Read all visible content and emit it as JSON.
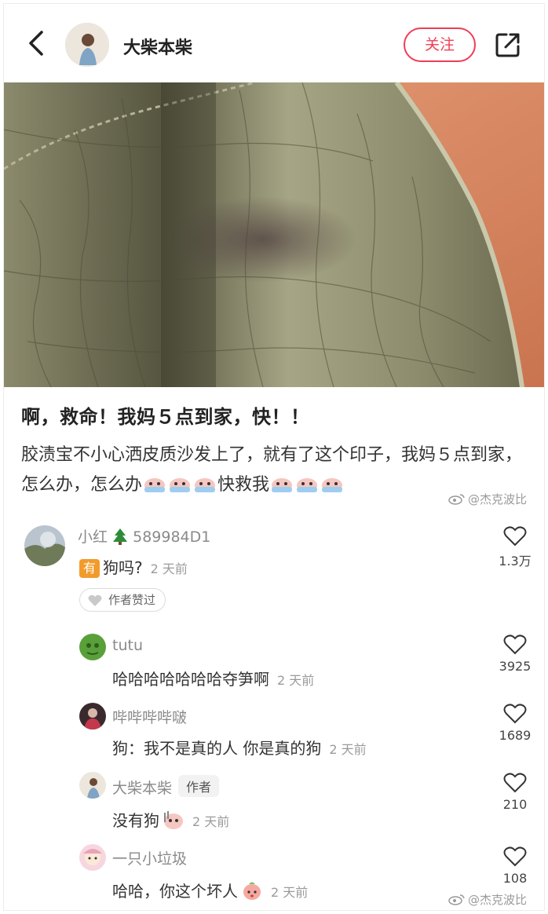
{
  "header": {
    "author_name": "大柴本柴",
    "follow_label": "关注"
  },
  "post": {
    "title": "啊，救命！我妈５点到家，快！！",
    "body_part1": "胶渍宝不小心洒皮质沙发上了，就有了这个印子，我妈５点到家，怎么办，怎么办",
    "body_part2": "快救我"
  },
  "watermarks": {
    "text": "@杰克波比"
  },
  "comments": [
    {
      "user": "小红",
      "user_suffix": "589984D1",
      "badge": "有",
      "text": "狗吗?",
      "time": "2 天前",
      "likes": "1.3万",
      "pill": "作者赞过"
    },
    {
      "user": "tutu",
      "text": "哈哈哈哈哈哈哈夺笋啊",
      "time": "2 天前",
      "likes": "3925"
    },
    {
      "user": "哔哔哔哔啵",
      "text": "狗：我不是真的人 你是真的狗",
      "time": "2 天前",
      "likes": "1689"
    },
    {
      "user": "大柴本柴",
      "author_tag": "作者",
      "text": "没有狗",
      "time": "2 天前",
      "likes": "210"
    },
    {
      "user": "一只小垃圾",
      "text": "哈哈，你这个坏人",
      "time": "2 天前",
      "likes": "108"
    }
  ],
  "colors": {
    "accent_red": "#ef3d55",
    "muted_text": "#8a8a8a",
    "badge_orange": "#f29b2b"
  }
}
